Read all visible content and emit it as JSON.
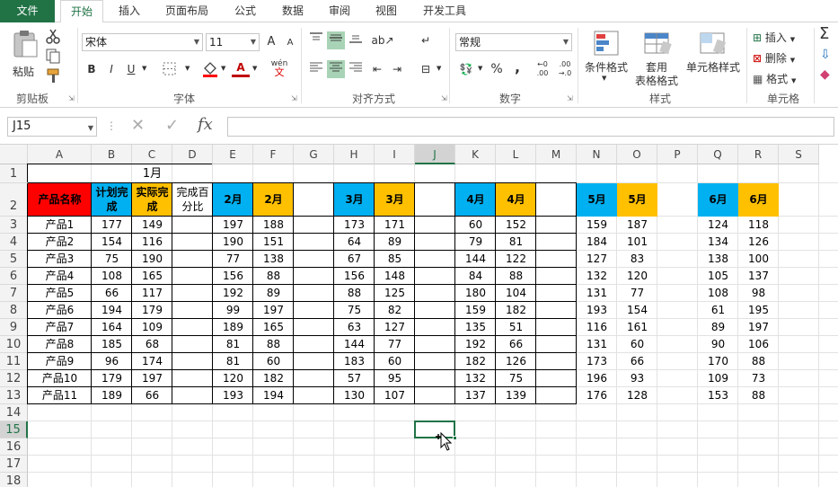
{
  "tabs": [
    "文件",
    "开始",
    "插入",
    "页面布局",
    "公式",
    "数据",
    "审阅",
    "视图",
    "开发工具"
  ],
  "ribbon": {
    "paste": "粘贴",
    "clipboard": "剪贴板",
    "font_name": "宋体",
    "font_size": "11",
    "font_group": "字体",
    "bold": "B",
    "italic": "I",
    "underline": "U",
    "grow": "A",
    "shrink": "A",
    "font_color": "A",
    "wen": "wén",
    "align_group": "对齐方式",
    "number_format": "常规",
    "percent": "%",
    "comma": ",",
    "dec_inc": "←0 .00",
    "dec_dec": ".00 →.0",
    "number_group": "数字",
    "cond_format": "条件格式",
    "table_format_1": "套用",
    "table_format_2": "表格格式",
    "cell_style": "单元格样式",
    "style_group": "样式",
    "insert": "插入",
    "delete": "删除",
    "format": "格式",
    "cells_group": "单元格",
    "sum": "Σ"
  },
  "formula_bar": {
    "name_box": "J15",
    "fx": "fx",
    "cancel": "✕",
    "enter": "✓"
  },
  "grid": {
    "columns": [
      "A",
      "B",
      "C",
      "D",
      "E",
      "F",
      "G",
      "H",
      "I",
      "J",
      "K",
      "L",
      "M",
      "N",
      "O",
      "P",
      "Q",
      "R",
      "S"
    ],
    "rows": [
      "1",
      "2",
      "3",
      "4",
      "5",
      "6",
      "7",
      "8",
      "9",
      "10",
      "11",
      "12",
      "13",
      "14",
      "15",
      "16",
      "17",
      "18"
    ],
    "title": "1月",
    "product_header": "产品名称",
    "plan_header": "计划完成",
    "actual_header": "实际完成",
    "percent_header": "完成百分比",
    "month_headers": [
      "2月",
      "2月",
      "3月",
      "3月",
      "4月",
      "4月",
      "5月",
      "5月",
      "6月",
      "6月"
    ],
    "products": [
      "产品1",
      "产品2",
      "产品3",
      "产品4",
      "产品5",
      "产品6",
      "产品7",
      "产品8",
      "产品9",
      "产品10",
      "产品11"
    ],
    "rows_data": [
      [
        177,
        149,
        197,
        188,
        173,
        171,
        60,
        152,
        159,
        187,
        124,
        118
      ],
      [
        154,
        116,
        190,
        151,
        64,
        89,
        79,
        81,
        184,
        101,
        134,
        126
      ],
      [
        75,
        190,
        77,
        138,
        67,
        85,
        144,
        122,
        127,
        83,
        138,
        100
      ],
      [
        108,
        165,
        156,
        88,
        156,
        148,
        84,
        88,
        132,
        120,
        105,
        137
      ],
      [
        66,
        117,
        192,
        89,
        88,
        125,
        180,
        104,
        131,
        77,
        108,
        98
      ],
      [
        194,
        179,
        99,
        197,
        75,
        82,
        159,
        182,
        193,
        154,
        61,
        195
      ],
      [
        164,
        109,
        189,
        165,
        63,
        127,
        135,
        51,
        116,
        161,
        89,
        197
      ],
      [
        185,
        68,
        81,
        88,
        144,
        77,
        192,
        66,
        131,
        60,
        90,
        106
      ],
      [
        96,
        174,
        81,
        60,
        183,
        60,
        182,
        126,
        173,
        66,
        170,
        88
      ],
      [
        179,
        197,
        120,
        182,
        57,
        95,
        132,
        75,
        196,
        93,
        109,
        73
      ],
      [
        189,
        66,
        193,
        194,
        130,
        107,
        137,
        139,
        176,
        128,
        153,
        88
      ]
    ]
  },
  "colors": {
    "excel_green": "#217346",
    "red": "#ff0000",
    "blue": "#00b0f0",
    "orange": "#ffc000"
  }
}
